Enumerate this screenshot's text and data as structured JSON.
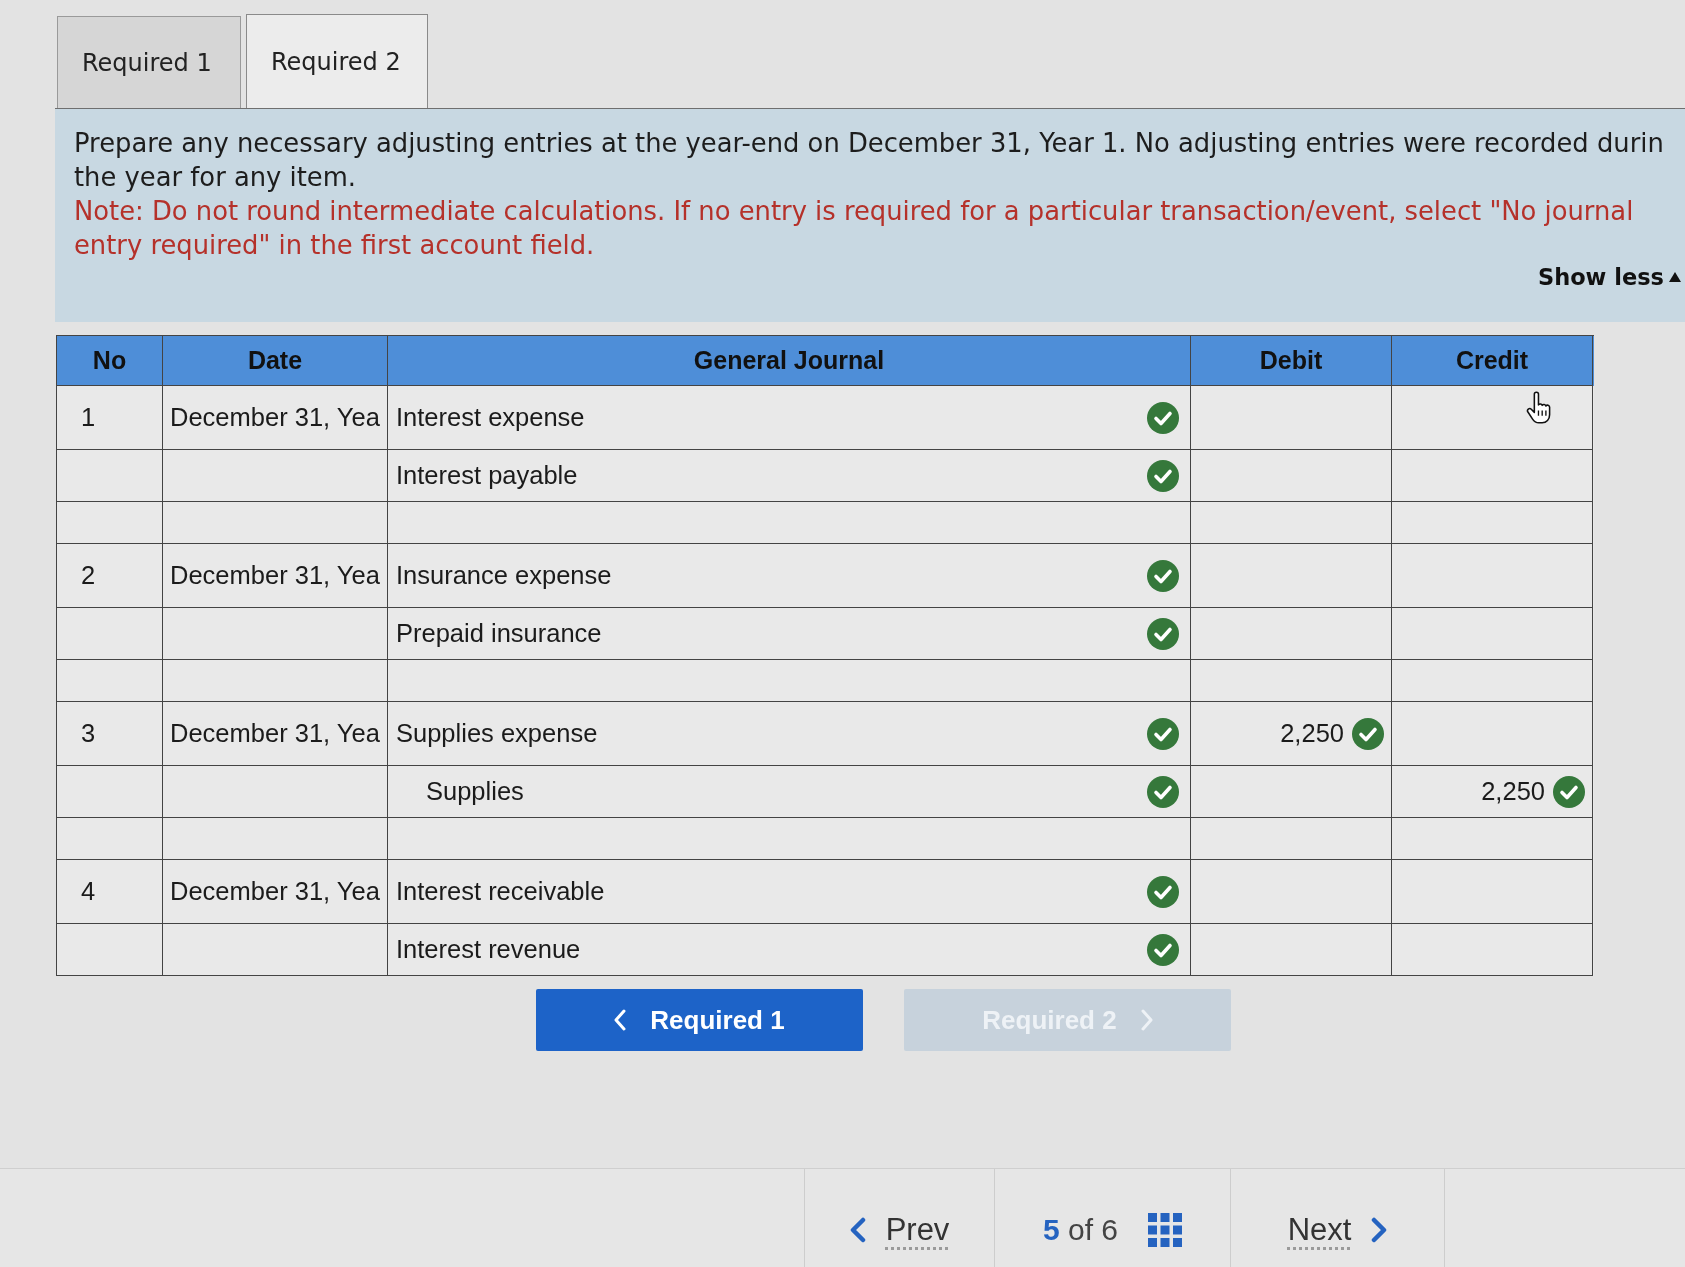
{
  "tabs": [
    {
      "label": "Required 1",
      "selected": false
    },
    {
      "label": "Required 2",
      "selected": true
    }
  ],
  "instructions": {
    "lines": [
      "Prepare any necessary adjusting entries at the year-end on December 31, Year 1. No adjusting entries were recorded durin",
      "the year for any item."
    ],
    "note": "Note: Do not round intermediate calculations. If no entry is required for a particular transaction/event, select \"No journal entry required\" in the first account field."
  },
  "show_toggle": {
    "label": "Show less",
    "expanded": true
  },
  "table": {
    "columns": [
      "No",
      "Date",
      "General Journal",
      "Debit",
      "Credit"
    ],
    "entries": [
      {
        "no": "1",
        "date": "December 31, Yea",
        "lines": [
          {
            "account": "Interest expense",
            "indented": false,
            "checked": true
          },
          {
            "account": "Interest payable",
            "indented": false,
            "checked": true
          }
        ]
      },
      {
        "no": "2",
        "date": "December 31, Yea",
        "lines": [
          {
            "account": "Insurance expense",
            "indented": false,
            "checked": true
          },
          {
            "account": "Prepaid insurance",
            "indented": false,
            "checked": true
          }
        ]
      },
      {
        "no": "3",
        "date": "December 31, Yea",
        "lines": [
          {
            "account": "Supplies expense",
            "indented": false,
            "checked": true,
            "debit": {
              "value": "2,250",
              "checked": true
            }
          },
          {
            "account": "Supplies",
            "indented": true,
            "checked": true,
            "credit": {
              "value": "2,250",
              "checked": true
            }
          }
        ]
      },
      {
        "no": "4",
        "date": "December 31, Yea",
        "lines": [
          {
            "account": "Interest receivable",
            "indented": false,
            "checked": true
          },
          {
            "account": "Interest revenue",
            "indented": false,
            "checked": true
          }
        ]
      }
    ]
  },
  "section_buttons": [
    {
      "kind": "back",
      "label": "Required 1",
      "disabled": false
    },
    {
      "kind": "forward",
      "label": "Required 2",
      "disabled": true
    }
  ],
  "pager": {
    "prev": "Prev",
    "position": "**5** of 6",
    "next": "Next"
  }
}
